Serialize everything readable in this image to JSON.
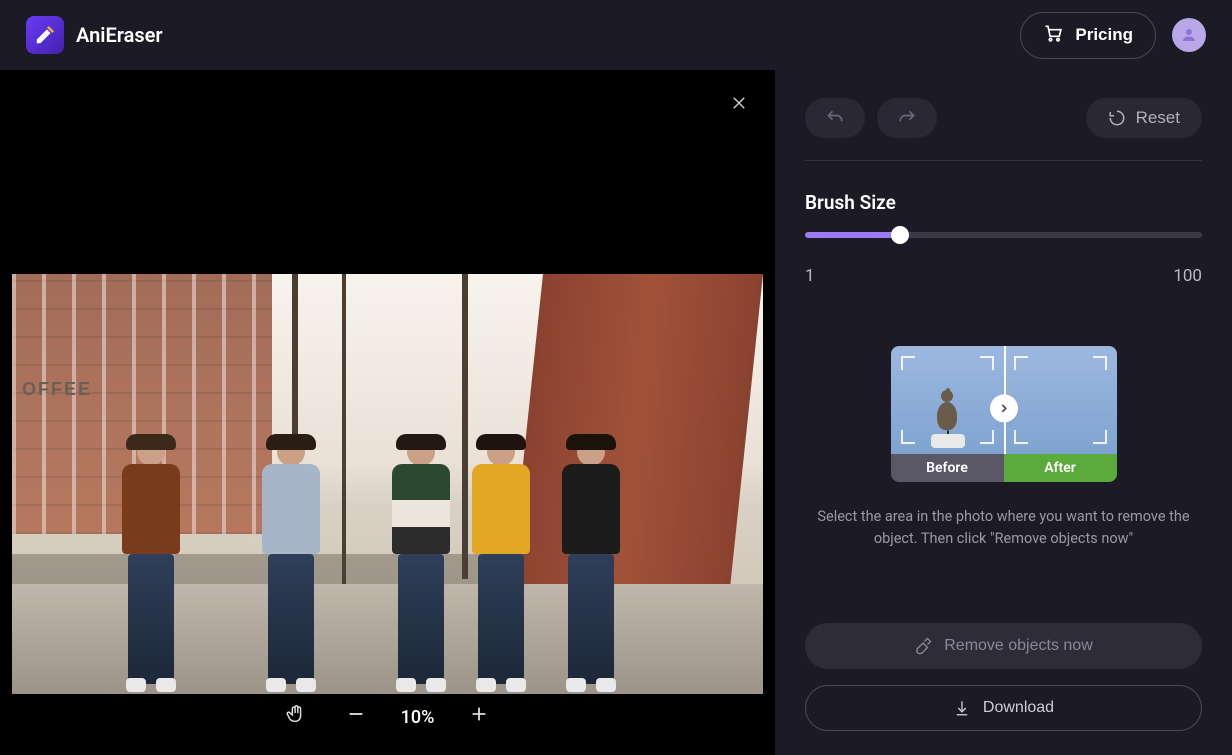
{
  "header": {
    "app_name": "AniEraser",
    "pricing_label": "Pricing"
  },
  "canvas": {
    "zoom_percent": "10%",
    "sign_text": "OFFEE"
  },
  "panel": {
    "reset_label": "Reset",
    "brush_title": "Brush Size",
    "brush_min": "1",
    "brush_max": "100",
    "brush_value": 24,
    "before_label": "Before",
    "after_label": "After",
    "instruction": "Select the area in the photo where you want to remove the object. Then click \"Remove objects now\"",
    "remove_label": "Remove objects now",
    "download_label": "Download"
  }
}
